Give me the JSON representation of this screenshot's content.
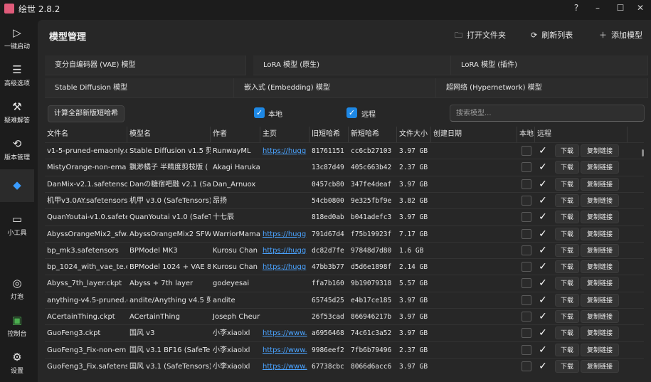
{
  "app": {
    "title": "绘世 2.8.2"
  },
  "window_controls": {
    "help": "?",
    "minimize": "–",
    "maximize": "☐",
    "close": "✕"
  },
  "sidebar": {
    "items": [
      {
        "icon": "▷",
        "label": "一键启动"
      },
      {
        "icon": "☰",
        "label": "高级选项"
      },
      {
        "icon": "⚒",
        "label": "疑难解答"
      },
      {
        "icon": "⟲",
        "label": "版本管理"
      },
      {
        "icon": "◆",
        "label": "",
        "active": true
      },
      {
        "icon": "▭",
        "label": "小工具"
      },
      {
        "icon": "◎",
        "label": "灯泡"
      },
      {
        "icon": "▣",
        "label": "控制台"
      },
      {
        "icon": "⚙",
        "label": "设置"
      }
    ]
  },
  "header": {
    "title": "模型管理",
    "open_folder": "打开文件夹",
    "refresh": "刷新列表",
    "add_model": "添加模型"
  },
  "tabs": [
    "变分自编码器 (VAE) 模型",
    "LoRA 模型 (原生)",
    "LoRA 模型 (插件)",
    "Stable Diffusion 模型",
    "嵌入式 (Embedding) 模型",
    "超网络 (Hypernetwork) 模型"
  ],
  "toolbar": {
    "calc_button": "计算全部新版短哈希",
    "local_label": "本地",
    "remote_label": "远程",
    "search_placeholder": "搜索模型..."
  },
  "table": {
    "columns": [
      "文件名",
      "模型名",
      "作者",
      "主页",
      "旧短哈希",
      "新短哈希",
      "文件大小",
      "创建日期",
      "本地",
      "远程"
    ],
    "download_label": "下载",
    "copy_label": "复制链接",
    "rows": [
      {
        "file": "v1-5-pruned-emaonly.c",
        "name": "Stable Diffusion v1.5 剪",
        "author": "RunwayML",
        "home": "https://hugg",
        "old": "81761151",
        "new": "cc6cb27103",
        "size": "3.97 GB"
      },
      {
        "file": "MistyOrange-non-ema",
        "name": "飘渺橘子 半精度剪枝版 (",
        "author": "Akagi Haruka",
        "home": "",
        "old": "13c87d49",
        "new": "405c663b42",
        "size": "2.37 GB"
      },
      {
        "file": "DanMix-v2.1.safetenso",
        "name": "Danの糖宿吧融 v2.1 (Sa",
        "author": "Dan_Arnuox",
        "home": "",
        "old": "0457cb80",
        "new": "347fe4deaf",
        "size": "3.97 GB"
      },
      {
        "file": "机甲v3.0AY.safetensors",
        "name": "机甲 v3.0 (SafeTensors)",
        "author": "昂扬",
        "home": "",
        "old": "54cb0800",
        "new": "9e325fbf9e",
        "size": "3.82 GB"
      },
      {
        "file": "QuanYoutai-v1.0.safete",
        "name": "QuanYoutai v1.0 (SafeT",
        "author": "十七辰",
        "home": "",
        "old": "818ed0ab",
        "new": "b041adefc3",
        "size": "3.97 GB"
      },
      {
        "file": "AbyssOrangeMix2_sfw.",
        "name": "AbyssOrangeMix2 SFW",
        "author": "WarriorMama",
        "home": "https://hugg",
        "old": "791d67d4",
        "new": "f75b19923f",
        "size": "7.17 GB"
      },
      {
        "file": "bp_mk3.safetensors",
        "name": "BPModel MK3",
        "author": "Kurosu Chan",
        "home": "https://hugg",
        "old": "dc82d7fe",
        "new": "97848d7d80",
        "size": "1.6 GB"
      },
      {
        "file": "bp_1024_with_vae_te.cl",
        "name": "BPModel 1024 + VAE 8",
        "author": "Kurosu Chan",
        "home": "https://hugg",
        "old": "47bb3b77",
        "new": "d5d6e1898f",
        "size": "2.14 GB"
      },
      {
        "file": "Abyss_7th_layer.ckpt",
        "name": "Abyss + 7th layer",
        "author": "godeyesai",
        "home": "",
        "old": "ffa7b160",
        "new": "9b19079318",
        "size": "5.57 GB"
      },
      {
        "file": "anything-v4.5-pruned.c",
        "name": "andite/Anything v4.5 剪",
        "author": "andite",
        "home": "",
        "old": "65745d25",
        "new": "e4b17ce185",
        "size": "3.97 GB"
      },
      {
        "file": "ACertainThing.ckpt",
        "name": "ACertainThing",
        "author": "Joseph Cheur",
        "home": "",
        "old": "26f53cad",
        "new": "866946217b",
        "size": "3.97 GB"
      },
      {
        "file": "GuoFeng3.ckpt",
        "name": "国风 v3",
        "author": "小李xiaolxl",
        "home": "https://www.",
        "old": "a6956468",
        "new": "74c61c3a52",
        "size": "3.97 GB"
      },
      {
        "file": "GuoFeng3_Fix-non-em",
        "name": "国风 v3.1 BF16 (SafeTer",
        "author": "小李xiaolxl",
        "home": "https://www.",
        "old": "9986eef2",
        "new": "7fb6b79496",
        "size": "2.37 GB"
      },
      {
        "file": "GuoFeng3_Fix.safetens",
        "name": "国风 v3.1 (SafeTensors)",
        "author": "小李xiaolxl",
        "home": "https://www.",
        "old": "67738cbc",
        "new": "8066d6acc6",
        "size": "3.97 GB"
      }
    ]
  }
}
